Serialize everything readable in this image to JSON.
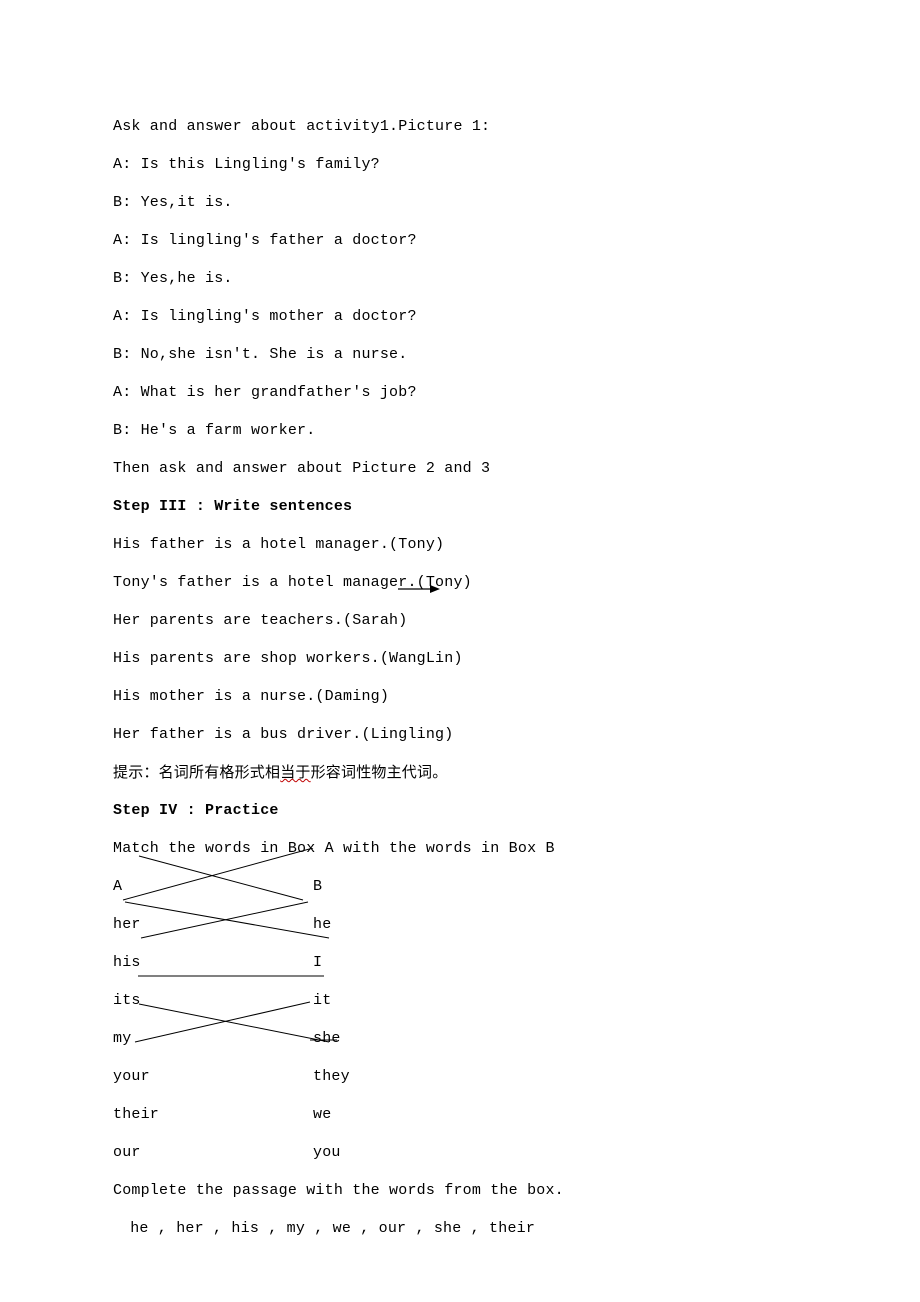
{
  "intro": "Ask and answer about activity1.Picture 1:",
  "dialog": {
    "l1": "A: Is this Lingling's family?",
    "l2": "B: Yes,it is.",
    "l3": "A: Is lingling's father a doctor?",
    "l4": "B: Yes,he is.",
    "l5": "A: Is lingling's mother a doctor?",
    "l6": "B: No,she isn't. She is a nurse.",
    "l7": "A: What is her grandfather's job?",
    "l8": "B: He's a farm worker."
  },
  "then_line": "Then ask and answer about Picture 2 and 3",
  "step3_heading": "Step III : Write sentences",
  "step3": {
    "s1a": "His father is a hotel manager.(Tony)",
    "s1b": "Tony's father is a hotel manager.(Tony)",
    "s2": "Her parents are teachers.(Sarah)",
    "s3": "His parents are shop workers.(WangLin)",
    "s4": "His mother is a nurse.(Daming)",
    "s5": "Her father is a bus driver.(Lingling)"
  },
  "tip_prefix": "提示：名词所有格形式相",
  "tip_word": "当于",
  "tip_suffix": "形容词性物主代词。",
  "step4_heading": "Step IV : Practice",
  "match_instruction": "Match the words in Box A with the words in Box B",
  "box": {
    "headA": "A",
    "headB": "B",
    "rows": [
      {
        "a": "her",
        "b": "he"
      },
      {
        "a": "his",
        "b": "I"
      },
      {
        "a": "its",
        "b": "it"
      },
      {
        "a": "my",
        "b": "she"
      },
      {
        "a": "your",
        "b": "they"
      },
      {
        "a": "their",
        "b": "we"
      },
      {
        "a": "our",
        "b": "you"
      }
    ]
  },
  "complete_instruction": "Complete the passage with the words from the box.",
  "word_box": " he , her , his , my , we , our , she , their"
}
